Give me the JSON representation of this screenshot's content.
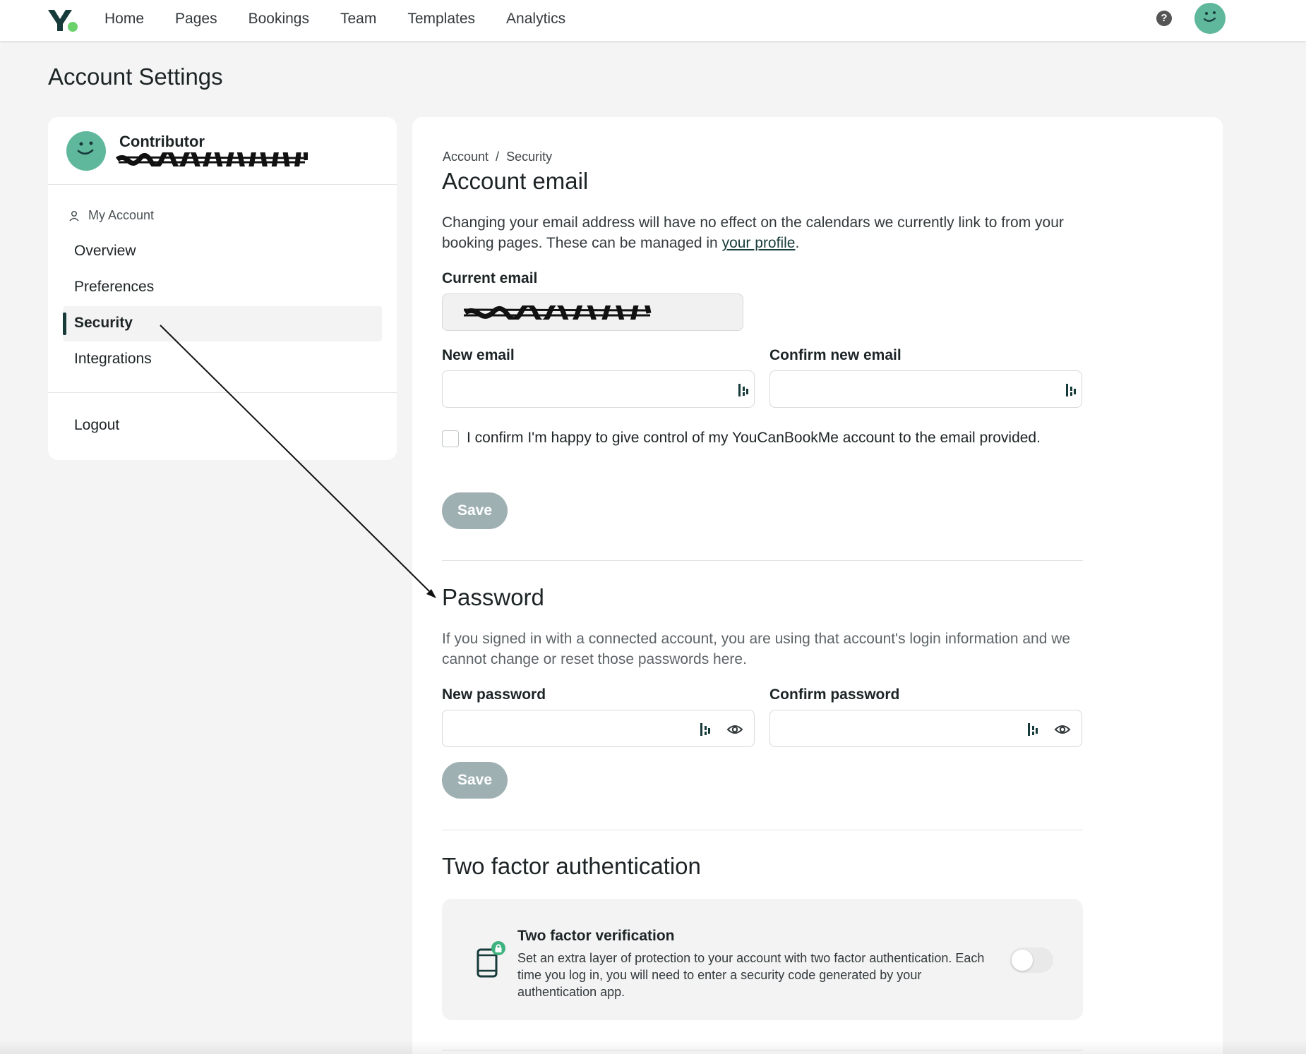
{
  "nav": {
    "links": [
      "Home",
      "Pages",
      "Bookings",
      "Team",
      "Templates",
      "Analytics"
    ],
    "help": "?"
  },
  "page_title": "Account Settings",
  "sidebar": {
    "role": "Contributor",
    "section": "My Account",
    "items": [
      "Overview",
      "Preferences",
      "Security",
      "Integrations"
    ],
    "logout": "Logout"
  },
  "main": {
    "breadcrumb": {
      "root": "Account",
      "sep": "/",
      "current": "Security"
    },
    "email": {
      "title": "Account email",
      "desc_start": "Changing your email address will have no effect on the calendars we currently link to from your booking pages. These can be managed in ",
      "desc_link": "your profile",
      "desc_end": ".",
      "current_label": "Current email",
      "new_label": "New email",
      "confirm_label": "Confirm new email",
      "confirm_text": "I confirm I'm happy to give control of my YouCanBookMe account to the email provided.",
      "save": "Save"
    },
    "password": {
      "title": "Password",
      "desc": "If you signed in with a connected account, you are using that account's login information and we cannot change or reset those passwords here.",
      "new_label": "New password",
      "confirm_label": "Confirm password",
      "save": "Save"
    },
    "tfa": {
      "title": "Two factor authentication",
      "card_title": "Two factor verification",
      "card_desc": "Set an extra layer of protection to your account with two factor authentication. Each time you log in, you will need to enter a security code generated by your authentication app."
    }
  },
  "colors": {
    "brand_dark": "#173a3a",
    "brand_green": "#6bd26b",
    "avatar": "#5fb89c",
    "button_disabled": "#9fb0b3"
  },
  "icons": [
    "logo-icon",
    "help-icon",
    "avatar-icon",
    "user-icon",
    "password-manager-icon",
    "eye-icon",
    "phone-lock-icon"
  ]
}
